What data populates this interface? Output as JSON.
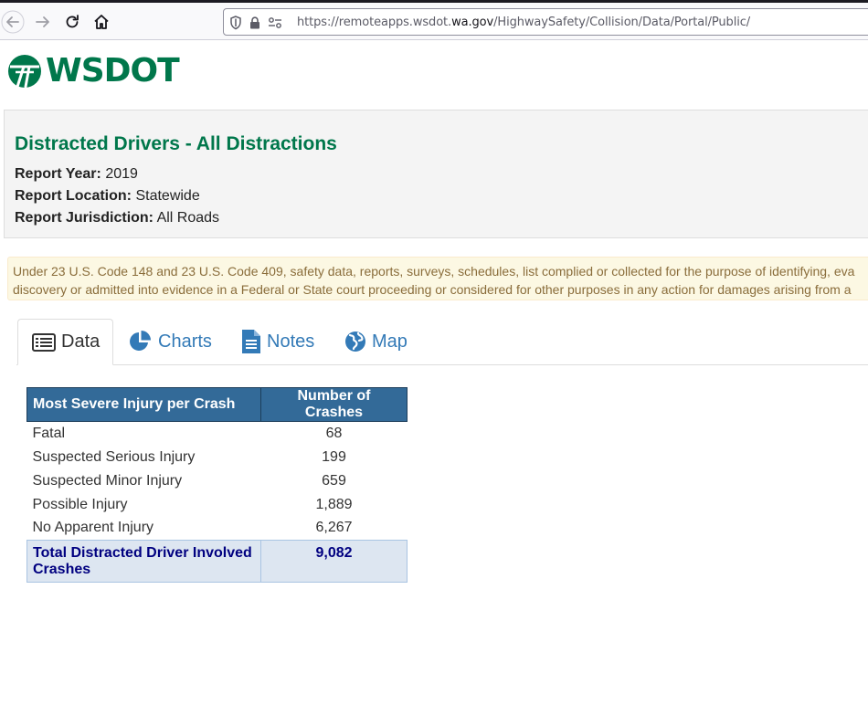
{
  "browser": {
    "url_prefix": "https://remoteapps.wsdot.",
    "url_host": "wa.gov",
    "url_path": "/HighwaySafety/Collision/Data/Portal/Public/"
  },
  "logo": {
    "text": "WSDOT",
    "color": "#00774b"
  },
  "report": {
    "title": "Distracted Drivers - All Distractions",
    "year_label": "Report Year:",
    "year_value": "2019",
    "location_label": "Report Location:",
    "location_value": "Statewide",
    "jurisdiction_label": "Report Jurisdiction:",
    "jurisdiction_value": "All Roads"
  },
  "disclaimer": {
    "line1": "Under 23 U.S. Code 148 and 23 U.S. Code 409, safety data, reports, surveys, schedules, list complied or collected for the purpose of identifying, eva",
    "line2": "discovery or admitted into evidence in a Federal or State court proceeding or considered for other purposes in any action for damages arising from a"
  },
  "tabs": [
    {
      "label": "Data",
      "icon": "table-icon",
      "active": true
    },
    {
      "label": "Charts",
      "icon": "pie-chart-icon",
      "active": false
    },
    {
      "label": "Notes",
      "icon": "document-icon",
      "active": false
    },
    {
      "label": "Map",
      "icon": "globe-icon",
      "active": false
    }
  ],
  "table": {
    "headers": [
      "Most Severe Injury per Crash",
      "Number of Crashes"
    ],
    "rows": [
      [
        "Fatal",
        "68"
      ],
      [
        "Suspected Serious Injury",
        "199"
      ],
      [
        "Suspected Minor Injury",
        "659"
      ],
      [
        "Possible Injury",
        "1,889"
      ],
      [
        "No Apparent Injury",
        "6,267"
      ]
    ],
    "total_label_line1": "Total Distracted Driver Involved",
    "total_label_line2": "Crashes",
    "total_value": "9,082"
  },
  "colors": {
    "brand_green": "#00774b",
    "header_blue": "#336a98",
    "tab_link": "#337ab7",
    "total_text": "#000080"
  }
}
